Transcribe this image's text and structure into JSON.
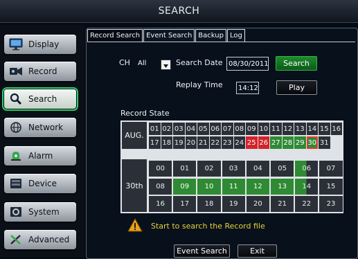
{
  "title": "SEARCH",
  "sidebar": {
    "items": [
      {
        "label": "Display",
        "icon": "monitor-icon"
      },
      {
        "label": "Record",
        "icon": "camera-icon"
      },
      {
        "label": "Search",
        "icon": "magnifier-icon",
        "active": true
      },
      {
        "label": "Network",
        "icon": "network-icon"
      },
      {
        "label": "Alarm",
        "icon": "alarm-icon"
      },
      {
        "label": "Device",
        "icon": "device-icon"
      },
      {
        "label": "System",
        "icon": "system-icon"
      },
      {
        "label": "Advanced",
        "icon": "tools-icon"
      }
    ]
  },
  "tabs": [
    "Record Search",
    "Event Search",
    "Backup",
    "Log"
  ],
  "form": {
    "ch_label": "CH",
    "ch_value": "All",
    "search_date_label": "Search Date",
    "search_date_value": "08/30/2011",
    "search_button": "Search",
    "replay_time_label": "Replay Time",
    "replay_time_value": "14:12",
    "play_button": "Play"
  },
  "record_state": {
    "label": "Record State",
    "month": "AUG.",
    "day": "30th",
    "days_row1": [
      "01",
      "02",
      "03",
      "04",
      "05",
      "06",
      "07",
      "08",
      "09",
      "10",
      "11",
      "12",
      "13",
      "14",
      "15",
      "16"
    ],
    "days_row2": [
      "17",
      "18",
      "19",
      "20",
      "21",
      "22",
      "23",
      "24",
      "25",
      "26",
      "27",
      "28",
      "29",
      "30",
      "31"
    ],
    "days_red": [
      "25",
      "26"
    ],
    "days_green": [
      "27",
      "28",
      "29",
      "30"
    ],
    "days_selected": "30",
    "hours_row1": [
      "00",
      "01",
      "02",
      "03",
      "04",
      "05",
      "06",
      "07"
    ],
    "hours_row2": [
      "08",
      "09",
      "10",
      "11",
      "12",
      "13",
      "14",
      "15"
    ],
    "hours_row3": [
      "16",
      "17",
      "18",
      "19",
      "20",
      "21",
      "22",
      "23"
    ],
    "hours_green": [
      "09",
      "10",
      "11",
      "12",
      "13"
    ],
    "hours_partial": [
      "06",
      "14"
    ]
  },
  "message": "Start to search the Record file",
  "footer": {
    "event_search_button": "Event Search",
    "exit_button": "Exit"
  },
  "colors": {
    "accent_green": "#2bd16a",
    "record_green": "#2f8a34",
    "record_red": "#d3222a",
    "message_yellow": "#e8d23a"
  }
}
